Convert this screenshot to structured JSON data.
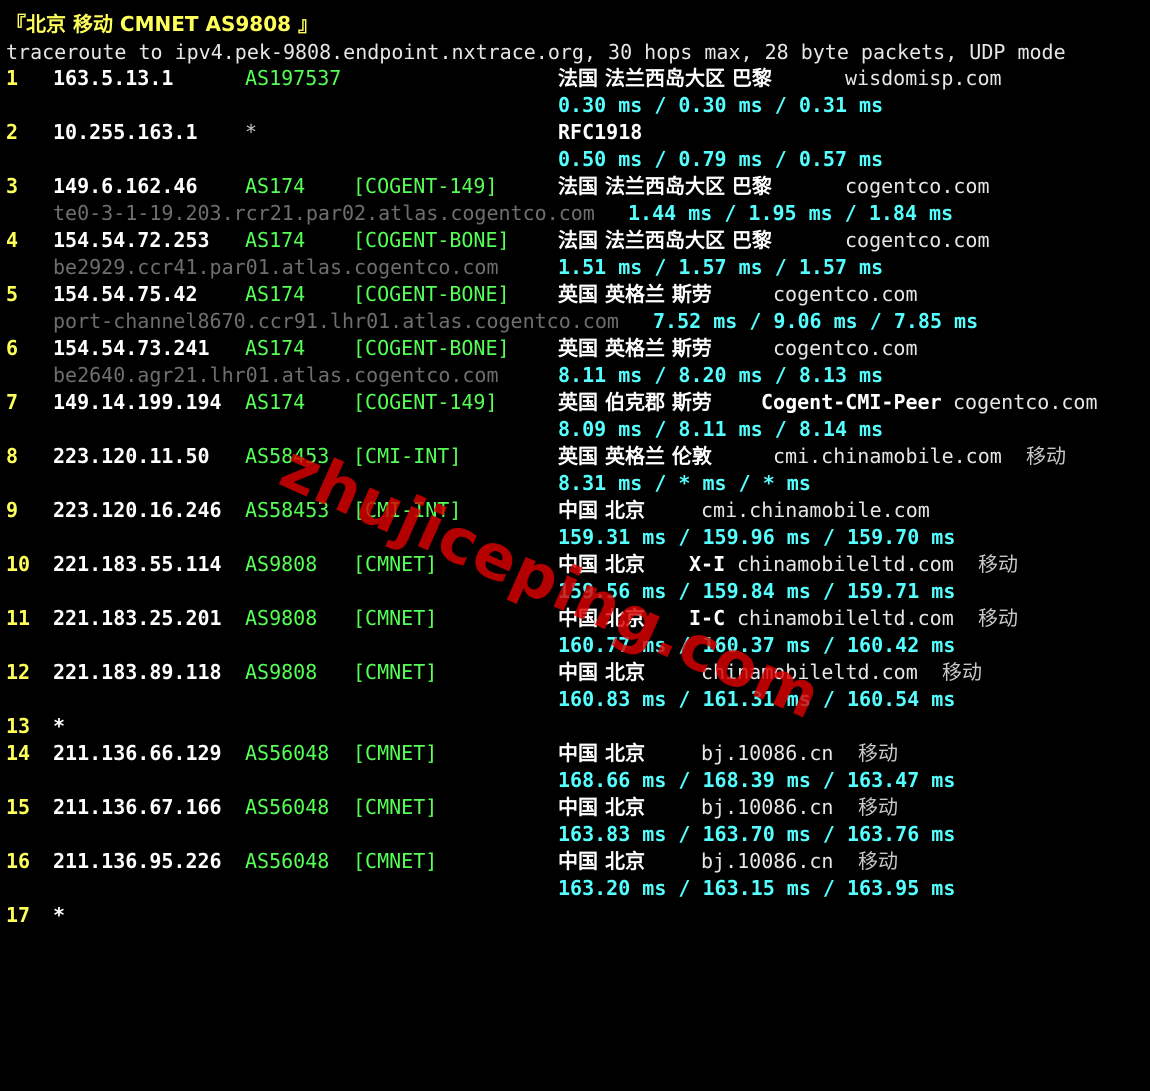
{
  "header": {
    "title": "『北京 移动 CMNET AS9808 』",
    "command": "traceroute to ipv4.pek-9808.endpoint.nxtrace.org, 30 hops max, 28 byte packets, UDP mode"
  },
  "watermark": "zhujiceping.com",
  "colors": {
    "hop_number": "#ffff5a",
    "asn": "#55ff55",
    "latency": "#55ffff",
    "rdns": "#6e6e6e",
    "background": "#000000"
  },
  "hops": [
    {
      "hop": "1",
      "ip": "163.5.13.1",
      "asn": "AS197537",
      "tag": "",
      "geo": "法国 法兰西岛大区 巴黎",
      "domain": "wisdomisp.com",
      "isp": "",
      "rdns": "",
      "rtt": "0.30 ms / 0.30 ms / 0.31 ms"
    },
    {
      "hop": "2",
      "ip": "10.255.163.1",
      "asn": "*",
      "tag": "",
      "geo": "RFC1918",
      "domain": "",
      "isp": "",
      "rdns": "",
      "rtt": "0.50 ms / 0.79 ms / 0.57 ms"
    },
    {
      "hop": "3",
      "ip": "149.6.162.46",
      "asn": "AS174",
      "tag": "[COGENT-149]",
      "geo": "法国 法兰西岛大区 巴黎",
      "domain": "cogentco.com",
      "isp": "",
      "rdns": "te0-3-1-19.203.rcr21.par02.atlas.cogentco.com",
      "rtt": "1.44 ms / 1.95 ms / 1.84 ms"
    },
    {
      "hop": "4",
      "ip": "154.54.72.253",
      "asn": "AS174",
      "tag": "[COGENT-BONE]",
      "geo": "法国 法兰西岛大区 巴黎",
      "domain": "cogentco.com",
      "isp": "",
      "rdns": "be2929.ccr41.par01.atlas.cogentco.com",
      "rtt": "1.51 ms / 1.57 ms / 1.57 ms"
    },
    {
      "hop": "5",
      "ip": "154.54.75.42",
      "asn": "AS174",
      "tag": "[COGENT-BONE]",
      "geo": "英国 英格兰 斯劳",
      "domain": "cogentco.com",
      "isp": "",
      "rdns": "port-channel8670.ccr91.lhr01.atlas.cogentco.com",
      "rtt": "7.52 ms / 9.06 ms / 7.85 ms"
    },
    {
      "hop": "6",
      "ip": "154.54.73.241",
      "asn": "AS174",
      "tag": "[COGENT-BONE]",
      "geo": "英国 英格兰 斯劳",
      "domain": "cogentco.com",
      "isp": "",
      "rdns": "be2640.agr21.lhr01.atlas.cogentco.com",
      "rtt": "8.11 ms / 8.20 ms / 8.13 ms"
    },
    {
      "hop": "7",
      "ip": "149.14.199.194",
      "asn": "AS174",
      "tag": "[COGENT-149]",
      "geo": "英国 伯克郡 斯劳",
      "geo_extra": "Cogent-CMI-Peer",
      "domain": "cogentco.com",
      "isp": "",
      "rdns": "",
      "rtt": "8.09 ms / 8.11 ms / 8.14 ms"
    },
    {
      "hop": "8",
      "ip": "223.120.11.50",
      "asn": "AS58453",
      "tag": "[CMI-INT]",
      "geo": "英国 英格兰 伦敦",
      "domain": "cmi.chinamobile.com",
      "isp": "移动",
      "rdns": "",
      "rtt": "8.31 ms / * ms / * ms"
    },
    {
      "hop": "9",
      "ip": "223.120.16.246",
      "asn": "AS58453",
      "tag": "[CMI-INT]",
      "geo": "中国 北京",
      "domain": "cmi.chinamobile.com",
      "isp": "",
      "rdns": "",
      "rtt": "159.31 ms / 159.96 ms / 159.70 ms"
    },
    {
      "hop": "10",
      "ip": "221.183.55.114",
      "asn": "AS9808",
      "tag": "[CMNET]",
      "geo": "中国 北京",
      "geo_extra": "X-I",
      "domain": "chinamobileltd.com",
      "isp": "移动",
      "rdns": "",
      "rtt": "159.56 ms / 159.84 ms / 159.71 ms"
    },
    {
      "hop": "11",
      "ip": "221.183.25.201",
      "asn": "AS9808",
      "tag": "[CMNET]",
      "geo": "中国 北京",
      "geo_extra": "I-C",
      "domain": "chinamobileltd.com",
      "isp": "移动",
      "rdns": "",
      "rtt": "160.77 ms / 160.37 ms / 160.42 ms"
    },
    {
      "hop": "12",
      "ip": "221.183.89.118",
      "asn": "AS9808",
      "tag": "[CMNET]",
      "geo": "中国 北京",
      "domain": "chinamobileltd.com",
      "isp": "移动",
      "rdns": "",
      "rtt": "160.83 ms / 161.31 ms / 160.54 ms"
    },
    {
      "hop": "13",
      "ip": "*"
    },
    {
      "hop": "14",
      "ip": "211.136.66.129",
      "asn": "AS56048",
      "tag": "[CMNET]",
      "geo": "中国 北京",
      "domain": "bj.10086.cn",
      "isp": "移动",
      "rdns": "",
      "rtt": "168.66 ms / 168.39 ms / 163.47 ms"
    },
    {
      "hop": "15",
      "ip": "211.136.67.166",
      "asn": "AS56048",
      "tag": "[CMNET]",
      "geo": "中国 北京",
      "domain": "bj.10086.cn",
      "isp": "移动",
      "rdns": "",
      "rtt": "163.83 ms / 163.70 ms / 163.76 ms"
    },
    {
      "hop": "16",
      "ip": "211.136.95.226",
      "asn": "AS56048",
      "tag": "[CMNET]",
      "geo": "中国 北京",
      "domain": "bj.10086.cn",
      "isp": "移动",
      "rdns": "",
      "rtt": "163.20 ms / 163.15 ms / 163.95 ms"
    },
    {
      "hop": "17",
      "ip": "*"
    }
  ]
}
